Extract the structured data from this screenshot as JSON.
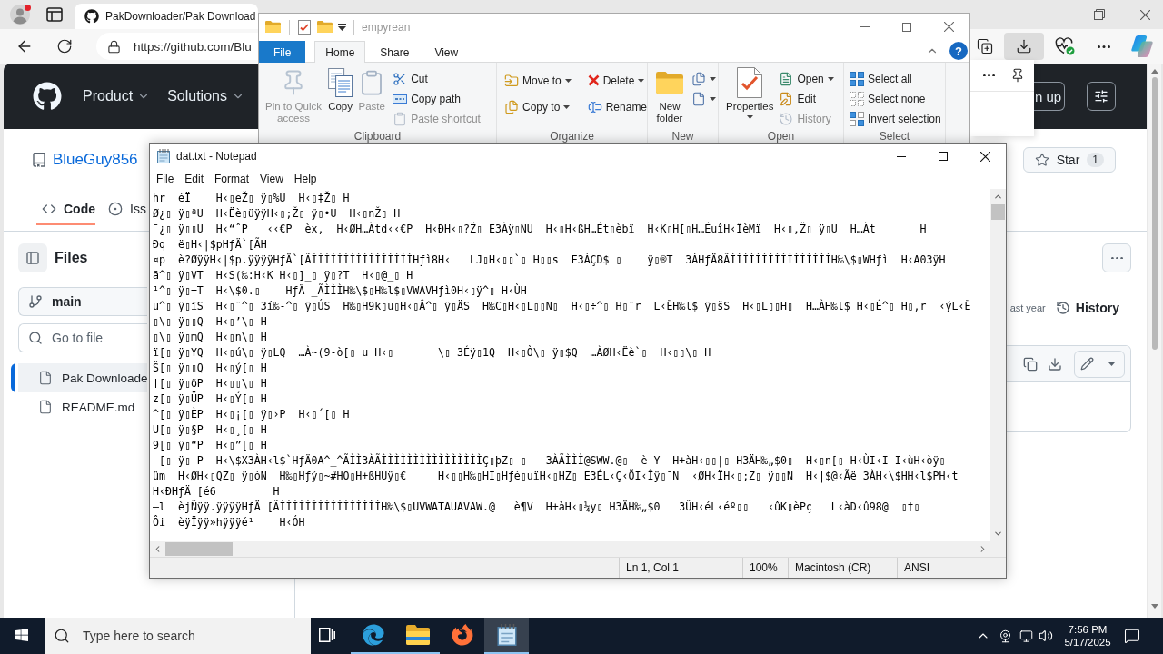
{
  "browser": {
    "tab_title": "PakDownloader/Pak Download",
    "address": "https://github.com/Blu",
    "toolbar": [
      {
        "kind": "collections",
        "selected": false
      },
      {
        "kind": "downloads",
        "selected": true
      },
      {
        "kind": "health",
        "selected": false
      },
      {
        "kind": "more",
        "selected": false
      },
      {
        "kind": "copilot",
        "selected": false
      }
    ]
  },
  "github": {
    "nav": [
      "Product",
      "Solutions"
    ],
    "signup": "n up",
    "owner": "BlueGuy856",
    "star_label": "Star",
    "star_count": "1",
    "tabs": [
      {
        "label": "Code",
        "kind": "code",
        "selected": true
      },
      {
        "label": "Iss",
        "kind": "issues",
        "selected": false
      }
    ],
    "files_title": "Files",
    "branch": "main",
    "search_placeholder": "Go to file",
    "files": [
      {
        "name": "Pak Downloade",
        "selected": true
      },
      {
        "name": "README.md",
        "selected": false
      }
    ],
    "commit_time": "last year",
    "history": "History"
  },
  "explorer": {
    "title": "empyrean",
    "help": "?",
    "tabs": [
      {
        "label": "File",
        "kind": "menu",
        "selected": false
      },
      {
        "label": "Home",
        "kind": "tab",
        "selected": true
      },
      {
        "label": "Share",
        "kind": "tab",
        "selected": false
      },
      {
        "label": "View",
        "kind": "tab",
        "selected": false
      }
    ],
    "groups": [
      {
        "label": "Clipboard",
        "columns": [
          {
            "kind": "large",
            "items": [
              {
                "kind": "pin",
                "label": "Pin to Quick access",
                "disabled": true,
                "dropdown": false
              }
            ]
          },
          {
            "kind": "large",
            "items": [
              {
                "kind": "copy",
                "label": "Copy",
                "disabled": false,
                "dropdown": false
              }
            ]
          },
          {
            "kind": "large",
            "items": [
              {
                "kind": "paste",
                "label": "Paste",
                "disabled": true,
                "dropdown": false
              }
            ]
          },
          {
            "kind": "stack",
            "items": [
              {
                "kind": "cut",
                "label": "Cut",
                "disabled": false,
                "dropdown": false
              },
              {
                "kind": "copy-path",
                "label": "Copy path",
                "disabled": false,
                "dropdown": false
              },
              {
                "kind": "paste-shortcut",
                "label": "Paste shortcut",
                "disabled": true,
                "dropdown": false
              }
            ]
          }
        ]
      },
      {
        "label": "Organize",
        "columns": [
          {
            "kind": "stack",
            "items": [
              {
                "kind": "move-to",
                "label": "Move to",
                "disabled": false,
                "dropdown": true
              },
              {
                "kind": "copy-to",
                "label": "Copy to",
                "disabled": false,
                "dropdown": true
              }
            ]
          },
          {
            "kind": "stack",
            "items": [
              {
                "kind": "delete",
                "label": "Delete",
                "disabled": false,
                "dropdown": true
              },
              {
                "kind": "rename",
                "label": "Rename",
                "disabled": false,
                "dropdown": false
              }
            ]
          }
        ]
      },
      {
        "label": "New",
        "columns": [
          {
            "kind": "large",
            "items": [
              {
                "kind": "new-folder",
                "label": "New folder",
                "disabled": false,
                "dropdown": false
              }
            ]
          },
          {
            "kind": "stack",
            "items": [
              {
                "kind": "new-item",
                "disabled": false,
                "dropdown": true
              },
              {
                "kind": "easy-access",
                "disabled": false,
                "dropdown": true
              }
            ]
          }
        ]
      },
      {
        "label": "Open",
        "columns": [
          {
            "kind": "large",
            "items": [
              {
                "kind": "properties",
                "label": "Properties",
                "disabled": false,
                "dropdown": true
              }
            ]
          },
          {
            "kind": "stack",
            "items": [
              {
                "kind": "open",
                "label": "Open",
                "disabled": false,
                "dropdown": true
              },
              {
                "kind": "edit",
                "label": "Edit",
                "disabled": false,
                "dropdown": false
              },
              {
                "kind": "history",
                "label": "History",
                "disabled": true,
                "dropdown": false
              }
            ]
          }
        ]
      },
      {
        "label": "Select",
        "columns": [
          {
            "kind": "stack",
            "items": [
              {
                "kind": "select-all",
                "label": "Select all",
                "disabled": false,
                "dropdown": false
              },
              {
                "kind": "select-none",
                "label": "Select none",
                "disabled": false,
                "dropdown": false
              },
              {
                "kind": "invert",
                "label": "Invert selection",
                "disabled": false,
                "dropdown": false
              }
            ]
          }
        ]
      }
    ]
  },
  "notepad": {
    "title": "dat.txt - Notepad",
    "menu": [
      "File",
      "Edit",
      "Format",
      "View",
      "Help"
    ],
    "lines": [
      "hr  éÏ    H‹▯eŽ▯ ÿ▯%U  H‹▯‡Ž▯ H",
      "Ø¿▯ ÿ▯ªU  H‹Ëè▯üÿÿH‹▯;Ž▯ ÿ▯•U  H‹▯nŽ▯ H",
      "¯¿▯ ÿ▯▯U  H‹“ˆP   ‹‹€P  èx,  H‹ØH…Àtd‹‹€P  H‹ÐH‹▯?Ž▯ E3Àÿ▯NU  H‹▯H‹ßH…Ét▯èbï  H‹K▯H[▯H…ÉuîH‹ÏèMï  H‹▯,Ž▯ ÿ▯U  H…Àt       H",
      "Ðq  ë▯H‹|$pHƒÄ`[ÃH",
      "¤p  è?ØÿÿH‹|$p.ÿÿÿÿHƒÄ`[ÃÌÌÌÌÌÌÌÌÌÌÌÌÌÌÌÌHƒì8H‹   LJ▯H‹▯▯`▯ H▯▯s  E3ÀÇD$ ▯    ÿ▯®T  3ÀHƒÄ8ÃÌÌÌÌÌÌÌÌÌÌÌÌÌÌÌÌH‰\\$▯WHƒì  H‹A03ÿH",
      "ã^▯ ÿ▯VT  H‹S(‰:H‹K H‹▯]_▯ ÿ▯?T  H‹▯@_▯ H",
      "¹^▯ ÿ▯+T  H‹\\$0.▯    HƒÄ _ÃÌÌÌH‰\\$▯H‰l$▯VWAVHƒì0H‹▯ÿ^▯ H‹ÙH",
      "u^▯ ÿ▯ïS  H‹▯¨^▯ 3í‰-^▯ ÿ▯ÚS  H‰▯H9k▯u▯H‹▯Â^▯ ÿ▯ÄS  H‰C▯H‹▯L▯▯N▯  H‹▯÷^▯ H▯¨r  L‹ËH‰l$ ÿ▯šS  H‹▯L▯▯H▯  H…ÀH‰l$ H‹▯É^▯ H▯,r  ‹ýL‹Ë",
      "▯\\▯ ÿ▯▯Q  H‹▯’\\▯ H",
      "▯\\▯ ÿ▯mQ  H‹▯n\\▯ H",
      "ï[▯ ÿ▯YQ  H‹▯ú\\▯ ÿ▯LQ  …À~(9-ò[▯ u H‹▯       \\▯ 3Éÿ▯1Q  H‹▯Ò\\▯ ÿ▯$Q  …ÀØH‹Ëè`▯  H‹▯▯\\▯ H",
      "Š[▯ ÿ▯▯Q  H‹▯ý[▯ H",
      "†[▯ ÿ▯ðP  H‹▯▯\\▯ H",
      "z[▯ ÿ▯ÜP  H‹▯Ý[▯ H",
      "^[▯ ÿ▯ÈP  H‹▯¡[▯ ÿ▯›P  H‹▯´[▯ H",
      "U[▯ ÿ▯§P  H‹▯¸[▯ H",
      "9[▯ ÿ▯“P  H‹▯”[▯ H",
      "-[▯ ÿ▯ P  H‹\\$X3ÀH‹l$`HƒÄ0A^_^ÃÌÌ3ÀÃÌÌÌÌÌÌÌÌÌÌÌÌÌÌÌÌÇ▯þZ▯ ▯   3ÀÃÌÌÌ@SWW.@▯  è Y  H+àH‹▯▯|▯ H3ÄH‰„$0▯  H‹▯n[▯ H‹ÙI‹I I‹ùH‹òÿ▯",
      "ûm  H‹ØH‹▯QZ▯ ÿ▯óN  H‰▯Hƒý▯~#HO▯H+ßHUÿ▯€     H‹▯▯H‰▯HI▯Hƒé▯uïH‹▯HZ▯ E3ÉL‹Ç‹ÕI‹Îÿ▯¯N  ‹ØH‹ÏH‹▯;Z▯ ÿ▯▯N  H‹|$@‹Ãë 3ÀH‹\\$HH‹l$PH‹t",
      "H‹ÐHƒÄ [é6         H",
      "—l  èjÑÿÿ.ÿÿÿÿHƒÄ [ÃÌÌÌÌÌÌÌÌÌÌÌÌÌÌÌÌH‰\\$▯UVWATAUAVAW.@   è¶V  H+àH‹▯¼y▯ H3ÄH‰„$0   3ÛH‹éL‹éº▯▯   ‹ûK▯èPç   L‹àD‹û98@  ▯†▯",
      "Ôi  èÿÏÿÿ»hÿÿÿé¹    H‹ÓH"
    ],
    "status": [
      "Ln 1, Col 1",
      "100%",
      "Macintosh (CR)",
      "ANSI"
    ]
  },
  "taskbar": {
    "search_placeholder": "Type here to search",
    "apps": [
      {
        "kind": "edge",
        "running": true,
        "selected": false
      },
      {
        "kind": "explorer",
        "running": true,
        "selected": false
      },
      {
        "kind": "firefox",
        "running": false,
        "selected": false
      },
      {
        "kind": "notepad",
        "running": true,
        "selected": true
      }
    ],
    "time": "7:56 PM",
    "date": "5/17/2025"
  }
}
